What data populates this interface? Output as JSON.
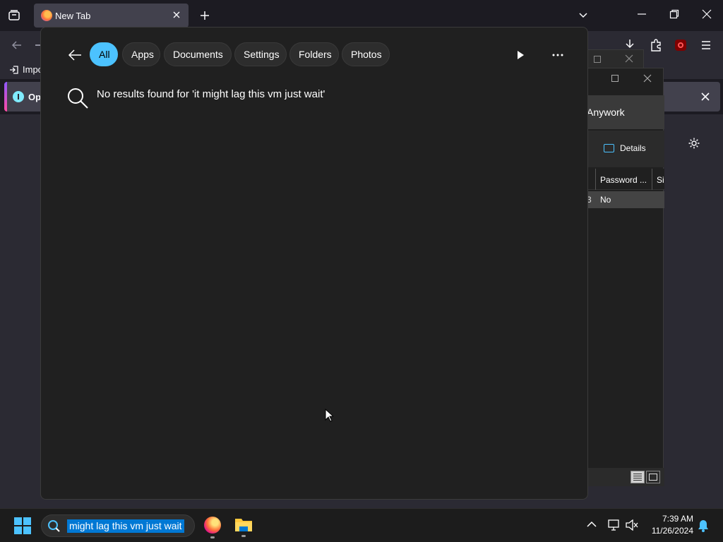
{
  "firefox": {
    "tab_title": "New Tab",
    "bookmark_label": "Impo",
    "notification_text": "Op",
    "colors": {
      "accent": "#9059ff",
      "tab_bg": "#42414d"
    }
  },
  "search_flyout": {
    "filters": [
      "All",
      "Apps",
      "Documents",
      "Settings",
      "Folders",
      "Photos"
    ],
    "active_filter": "All",
    "message": "No results found for 'it might lag this vm just wait'",
    "colors": {
      "accent": "#4cc2ff"
    }
  },
  "explorer": {
    "address_text": "Anywork",
    "details_label": "Details",
    "column_password": "Password ...",
    "column_size": "Si",
    "row_cell_prefix": "3",
    "row_password": "No"
  },
  "taskbar": {
    "search_query": "might lag this vm just wait",
    "time": "7:39 AM",
    "date": "11/26/2024"
  }
}
